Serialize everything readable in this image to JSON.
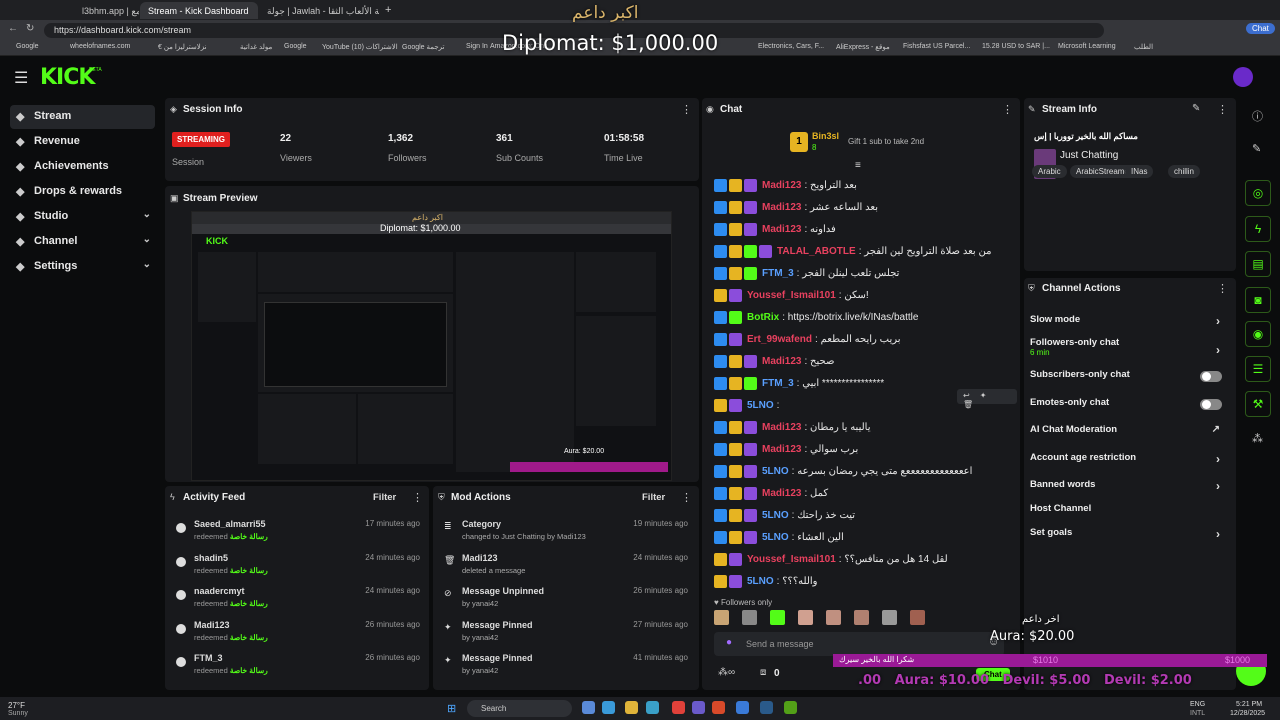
{
  "browser": {
    "tabs": [
      "l3bhm.app | المجمع",
      "Stream - Kick Dashboard",
      "جولة | Jawlah - منصة الألعاب الثقا..."
    ],
    "url": "https://dashboard.kick.com/stream",
    "bookmarks": [
      "Google",
      "wheelofnames.com",
      "€ نزلاسترليزا من",
      "مولد غداتية",
      "Google",
      "YouTube (10) الاشتراكات",
      "Google ترجمة",
      "Sign In",
      "Amazon.com: Onli...",
      "Electronics, Cars, F...",
      "AliExpress - موقع",
      "Fishsfast US Parcel...",
      "15.28 USD to SAR |...",
      "Microsoft Learning",
      "الطلب"
    ],
    "profile": "Chat"
  },
  "overlay": {
    "top_name": "اكبر داعم",
    "top_amount": "Diplomat: $1,000.00",
    "bottom_name": "اخر داعم",
    "bottom_amount": "Aura: $20.00",
    "ticker": ".00   Aura: $10.00   Devil: $5.00   Devil: $2.00",
    "ticker_left": "شكرا الله بالخير سيرك",
    "ticker_mid": "$1010",
    "ticker_right": "$1000"
  },
  "app": {
    "logo": "KICK",
    "logo_badge": "BETA"
  },
  "sidebar": {
    "items": [
      {
        "label": "Stream",
        "icon": "stream-icon",
        "selected": true
      },
      {
        "label": "Revenue",
        "icon": "revenue-icon"
      },
      {
        "label": "Achievements",
        "icon": "trophy-icon"
      },
      {
        "label": "Drops & rewards",
        "icon": "gift-icon"
      },
      {
        "label": "Studio",
        "icon": "gear-icon",
        "chevron": true
      },
      {
        "label": "Channel",
        "icon": "user-icon",
        "chevron": true
      },
      {
        "label": "Settings",
        "icon": "gear-icon",
        "chevron": true
      }
    ]
  },
  "session": {
    "title": "Session Info",
    "status": "STREAMING",
    "session_label": "Session",
    "viewers": "22",
    "viewers_label": "Viewers",
    "followers": "1,362",
    "followers_label": "Followers",
    "subs": "361",
    "subs_label": "Sub Counts",
    "time": "01:58:58",
    "time_label": "Time Live"
  },
  "preview": {
    "title": "Stream Preview",
    "inner_top": "اكبر داعم",
    "inner_amount": "Diplomat: $1,000.00",
    "inner_bottom": "Aura: $20.00"
  },
  "activity": {
    "title": "Activity Feed",
    "filter": "Filter",
    "items": [
      {
        "name": "Saeed_almarri55",
        "sub": "redeemed",
        "reward": "رسالة خاصة",
        "time": "17 minutes ago"
      },
      {
        "name": "shadin5",
        "sub": "redeemed",
        "reward": "رسالة خاصة",
        "time": "24 minutes ago"
      },
      {
        "name": "naadercmyt",
        "sub": "redeemed",
        "reward": "رسالة خاصة",
        "time": "24 minutes ago"
      },
      {
        "name": "Madi123",
        "sub": "redeemed",
        "reward": "رسالة خاصة",
        "time": "26 minutes ago"
      },
      {
        "name": "FTM_3",
        "sub": "redeemed",
        "reward": "رسالة خاصة",
        "time": "26 minutes ago"
      }
    ]
  },
  "mod": {
    "title": "Mod Actions",
    "filter": "Filter",
    "items": [
      {
        "name": "Category",
        "sub": "changed to Just Chatting by Madi123",
        "time": "19 minutes ago"
      },
      {
        "name": "Madi123",
        "sub": "deleted a message",
        "time": "24 minutes ago"
      },
      {
        "name": "Message Unpinned",
        "sub": "by yanai42",
        "time": "26 minutes ago"
      },
      {
        "name": "Message Pinned",
        "sub": "by yanai42",
        "time": "27 minutes ago"
      },
      {
        "name": "Message Pinned",
        "sub": "by yanai42",
        "time": "41 minutes ago"
      }
    ]
  },
  "chat": {
    "title": "Chat",
    "gifter": "Bin3sl",
    "gifter_count": "8",
    "gift_msg": "Gift 1 sub to take 2nd",
    "rank": "1",
    "messages": [
      {
        "user": "Madi123",
        "color": "#e8415f",
        "text": "بعد التراويح",
        "badges": [
          "blue",
          "gold",
          "purple"
        ]
      },
      {
        "user": "Madi123",
        "color": "#e8415f",
        "text": "بعد الساعه عشر",
        "badges": [
          "blue",
          "gold",
          "purple"
        ]
      },
      {
        "user": "Madi123",
        "color": "#e8415f",
        "text": "فداونه",
        "badges": [
          "blue",
          "gold",
          "purple"
        ]
      },
      {
        "user": "TALAL_ABOTLE",
        "color": "#e8415f",
        "text": "من بعد صلاة التراويح لين الفجر",
        "badges": [
          "blue",
          "gold",
          "green",
          "purple"
        ]
      },
      {
        "user": "FTM_3",
        "color": "#5aa0ff",
        "text": "تجلس تلعب لينلن الفجر",
        "badges": [
          "blue",
          "gold",
          "green"
        ]
      },
      {
        "user": "Youssef_Ismail101",
        "color": "#e8415f",
        "text": "سكن!",
        "badges": [
          "gold",
          "purple"
        ]
      },
      {
        "user": "BotRix",
        "color": "#53fc18",
        "text": "https://botrix.live/k/INas/battle",
        "badges": [
          "blue",
          "green"
        ]
      },
      {
        "user": "Ert_99wafend",
        "color": "#e8415f",
        "text": "بريب رايحه المطعم",
        "badges": [
          "blue",
          "purple"
        ]
      },
      {
        "user": "Madi123",
        "color": "#e8415f",
        "text": "صحيح",
        "badges": [
          "blue",
          "gold",
          "purple"
        ]
      },
      {
        "user": "FTM_3",
        "color": "#5aa0ff",
        "text": "ابيي ****************",
        "badges": [
          "blue",
          "gold",
          "green"
        ]
      },
      {
        "user": "5LNO",
        "color": "#5aa0ff",
        "text": "",
        "badges": [
          "gold",
          "purple"
        ]
      },
      {
        "user": "Madi123",
        "color": "#e8415f",
        "text": "ياليبه يا رمطان",
        "badges": [
          "blue",
          "gold",
          "purple"
        ]
      },
      {
        "user": "Madi123",
        "color": "#e8415f",
        "text": "برب سوالي",
        "badges": [
          "blue",
          "gold",
          "purple"
        ]
      },
      {
        "user": "5LNO",
        "color": "#5aa0ff",
        "text": "اعععععععععععععع متى يجي رمضان بسرعه",
        "badges": [
          "blue",
          "gold",
          "purple"
        ]
      },
      {
        "user": "Madi123",
        "color": "#e8415f",
        "text": "كمل",
        "badges": [
          "blue",
          "gold",
          "purple"
        ]
      },
      {
        "user": "5LNO",
        "color": "#5aa0ff",
        "text": "تيت خذ راحتك",
        "badges": [
          "blue",
          "gold",
          "purple"
        ]
      },
      {
        "user": "5LNO",
        "color": "#5aa0ff",
        "text": "الين العشاء",
        "badges": [
          "blue",
          "gold",
          "purple"
        ]
      },
      {
        "user": "Youssef_Ismail101",
        "color": "#e8415f",
        "text": "لقل 14 هل من منافس؟؟",
        "badges": [
          "gold",
          "purple"
        ]
      },
      {
        "user": "5LNO",
        "color": "#5aa0ff",
        "text": "والله؟؟؟",
        "badges": [
          "gold",
          "purple"
        ]
      }
    ],
    "followers_only": "Followers only",
    "send_placeholder": "Send a message",
    "count": "0",
    "chat_button": "Chat"
  },
  "streaminfo": {
    "title": "Stream Info",
    "stream_title": "مساكم الله بالخير تووربا | إس",
    "category": "Just Chatting",
    "tags": [
      "Arabic",
      "ArabicStreamer",
      "INas",
      "chillin"
    ]
  },
  "channel_actions": {
    "title": "Channel Actions",
    "items": [
      {
        "label": "Slow mode",
        "type": "chevron"
      },
      {
        "label": "Followers-only chat",
        "sub": "6 min",
        "type": "chevron"
      },
      {
        "label": "Subscribers-only chat",
        "type": "toggle"
      },
      {
        "label": "Emotes-only chat",
        "type": "toggle"
      },
      {
        "label": "AI Chat Moderation",
        "type": "external"
      },
      {
        "label": "Account age restriction",
        "type": "chevron"
      },
      {
        "label": "Banned words",
        "type": "chevron"
      },
      {
        "label": "Host Channel",
        "type": "none"
      },
      {
        "label": "Set goals",
        "type": "chevron"
      }
    ]
  },
  "taskbar": {
    "weather_temp": "27°F",
    "weather_desc": "Sunny",
    "search": "Search",
    "lang": "ENG",
    "lang2": "INTL",
    "time": "5:21 PM",
    "date": "12/28/2025"
  }
}
